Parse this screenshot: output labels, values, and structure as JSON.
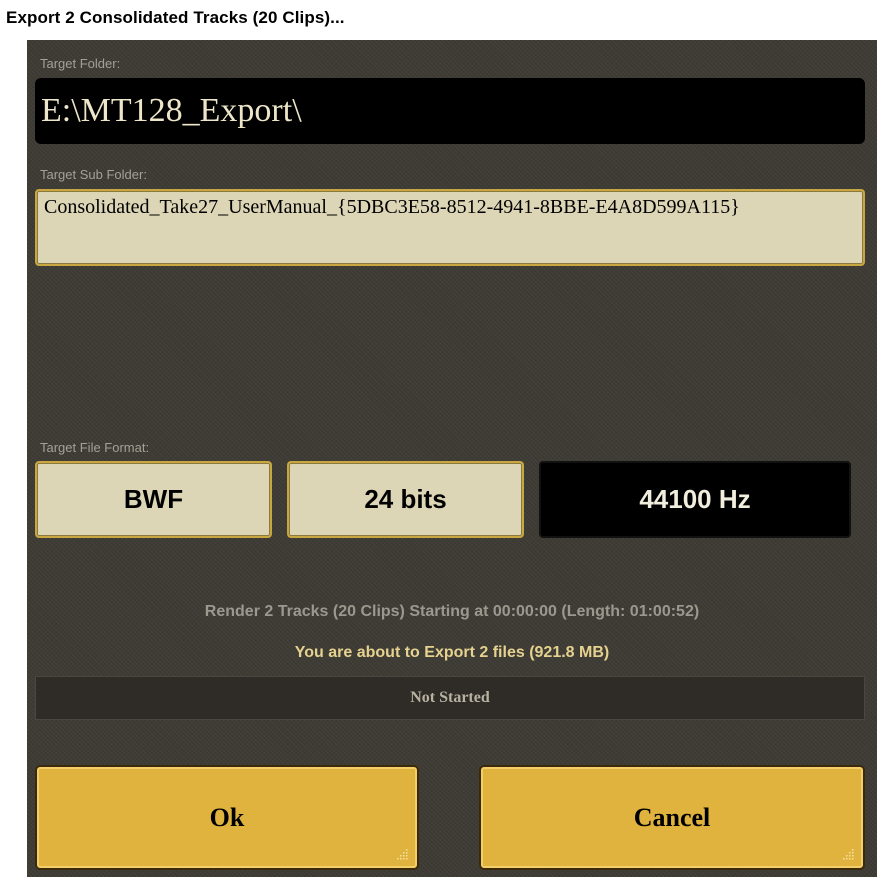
{
  "window": {
    "title": "Export 2 Consolidated Tracks (20 Clips)..."
  },
  "target_folder": {
    "label": "Target Folder:",
    "value": "E:\\MT128_Export\\"
  },
  "target_sub_folder": {
    "label": "Target Sub Folder:",
    "value": "Consolidated_Take27_UserManual_{5DBC3E58-8512-4941-8BBE-E4A8D599A115}"
  },
  "file_format": {
    "label": "Target File Format:",
    "format": "BWF",
    "bit_depth": "24 bits",
    "sample_rate": "44100 Hz"
  },
  "summary": {
    "render_info": "Render 2 Tracks (20 Clips) Starting at 00:00:00 (Length: 01:00:52)",
    "export_info": "You are about to Export 2 files (921.8 MB)"
  },
  "progress": {
    "status": "Not Started",
    "fraction": 0
  },
  "buttons": {
    "ok": "Ok",
    "cancel": "Cancel"
  },
  "colors": {
    "panel_bg": "#3e3b35",
    "field_light": "#ddd6b6",
    "field_dark": "#000000",
    "button_gold": "#e0b33f",
    "highlight_text": "#e6d28f"
  }
}
